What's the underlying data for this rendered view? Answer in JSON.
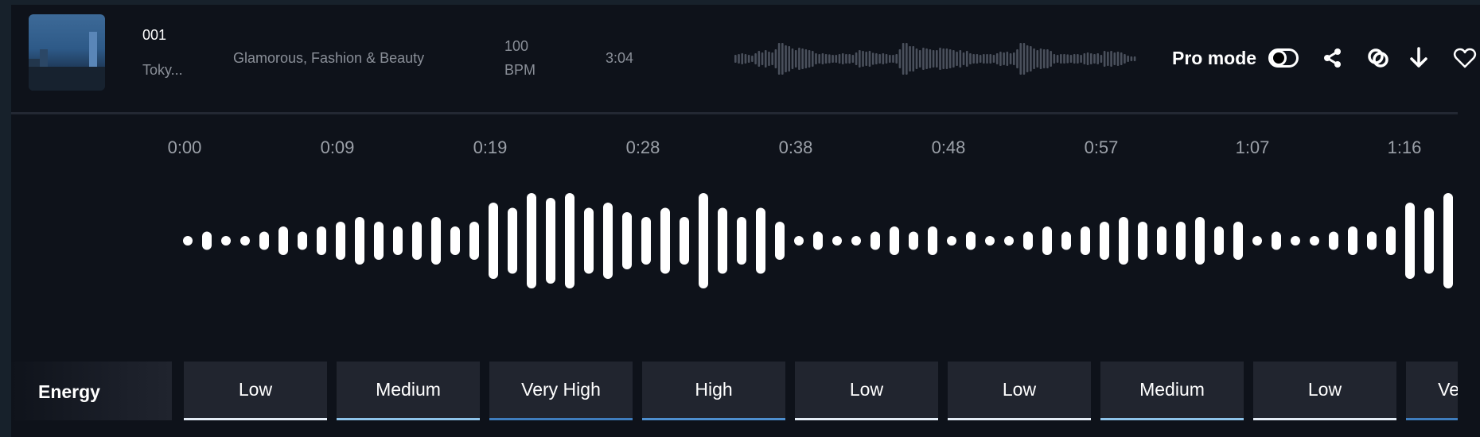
{
  "track": {
    "number": "001",
    "title_truncated": "Toky...",
    "genre": "Glamorous, Fashion & Beauty",
    "bpm_value": "100",
    "bpm_unit": "BPM",
    "duration": "3:04",
    "preview_waveform": [
      0.25,
      0.3,
      0.35,
      0.3,
      0.25,
      0.2,
      0.35,
      0.5,
      0.4,
      0.55,
      0.45,
      0.4,
      0.6,
      1,
      1,
      0.85,
      0.8,
      0.65,
      0.55,
      0.7,
      0.65,
      0.6,
      0.55,
      0.5,
      0.35,
      0.3,
      0.35,
      0.3,
      0.28,
      0.25,
      0.25,
      0.3,
      0.35,
      0.3,
      0.3,
      0.25,
      0.4,
      0.55,
      0.5,
      0.45,
      0.5,
      0.38,
      0.35,
      0.3,
      0.35,
      0.3,
      0.25,
      0.25,
      0.3,
      0.6,
      1,
      1,
      0.8,
      0.8,
      0.65,
      0.55,
      0.7,
      0.65,
      0.6,
      0.55,
      0.55,
      0.7,
      0.65,
      0.65,
      0.6,
      0.55,
      0.45,
      0.55,
      0.4,
      0.5,
      0.35,
      0.3,
      0.3,
      0.25,
      0.3,
      0.3,
      0.3,
      0.25,
      0.35,
      0.45,
      0.4,
      0.45,
      0.35,
      0.4,
      0.6,
      1,
      1,
      0.85,
      0.8,
      0.65,
      0.55,
      0.65,
      0.6,
      0.6,
      0.5,
      0.3,
      0.25,
      0.3,
      0.3,
      0.28,
      0.25,
      0.3,
      0.3,
      0.25,
      0.35,
      0.4,
      0.35,
      0.3,
      0.35,
      0.25,
      0.5,
      0.45,
      0.5,
      0.4,
      0.45,
      0.4,
      0.3,
      0.2,
      0.15,
      0.15
    ]
  },
  "actions": {
    "pro_mode_label": "Pro mode",
    "pro_mode_on": false,
    "icons": [
      "share-icon",
      "link-icon",
      "download-icon",
      "heart-icon"
    ]
  },
  "timeline": {
    "labels": [
      "0:00",
      "0:09",
      "0:19",
      "0:28",
      "0:38",
      "0:48",
      "0:57",
      "1:07",
      "1:16"
    ]
  },
  "waveform_amplitude": [
    0,
    1,
    0,
    0,
    1,
    2,
    1,
    2,
    3,
    4,
    3,
    2,
    3,
    4,
    2,
    3,
    7,
    6,
    9,
    8,
    9,
    6,
    7,
    5,
    4,
    6,
    4,
    9,
    6,
    4,
    6,
    3,
    0,
    1,
    0,
    0,
    1,
    2,
    1,
    2,
    0,
    1,
    0,
    0,
    1,
    2,
    1,
    2,
    3,
    4,
    3,
    2,
    3,
    4,
    2,
    3,
    0,
    1,
    0,
    0,
    1,
    2,
    1,
    2,
    7,
    6,
    9
  ],
  "waveform_max_level": 9,
  "energy": {
    "label": "Energy",
    "segments": [
      {
        "level": "Low"
      },
      {
        "level": "Medium"
      },
      {
        "level": "Very High"
      },
      {
        "level": "High"
      },
      {
        "level": "Low"
      },
      {
        "level": "Low"
      },
      {
        "level": "Medium"
      },
      {
        "level": "Low"
      },
      {
        "level": "Very High"
      }
    ],
    "colors": {
      "Low": "#e4edf6",
      "Medium": "#8fc4ea",
      "High": "#4e8fcf",
      "Very High": "#3f7dbd"
    }
  },
  "colors": {
    "background": "#0e121a",
    "cell": "#21252f",
    "waveform": "#ffffff",
    "preview_waveform": "#4a505c"
  }
}
